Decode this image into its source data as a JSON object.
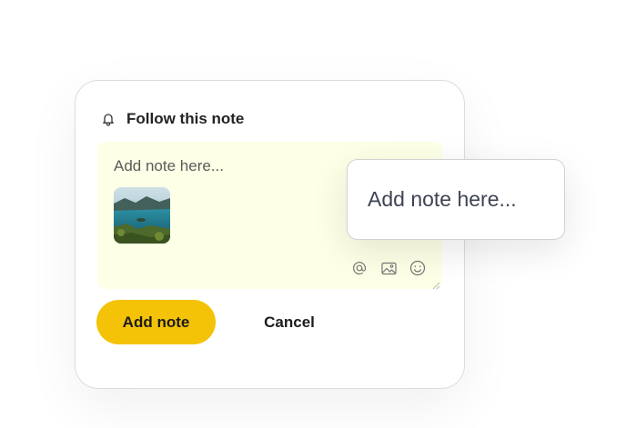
{
  "follow": {
    "label": "Follow this note",
    "icon": "bell-icon"
  },
  "note": {
    "placeholder": "Add note here...",
    "background": "#fdffe6",
    "tools": [
      "at-sign-icon",
      "image-icon",
      "emoji-icon"
    ]
  },
  "actions": {
    "add_label": "Add note",
    "cancel_label": "Cancel",
    "accent": "#f4c307"
  },
  "popup": {
    "placeholder": "Add note here..."
  }
}
